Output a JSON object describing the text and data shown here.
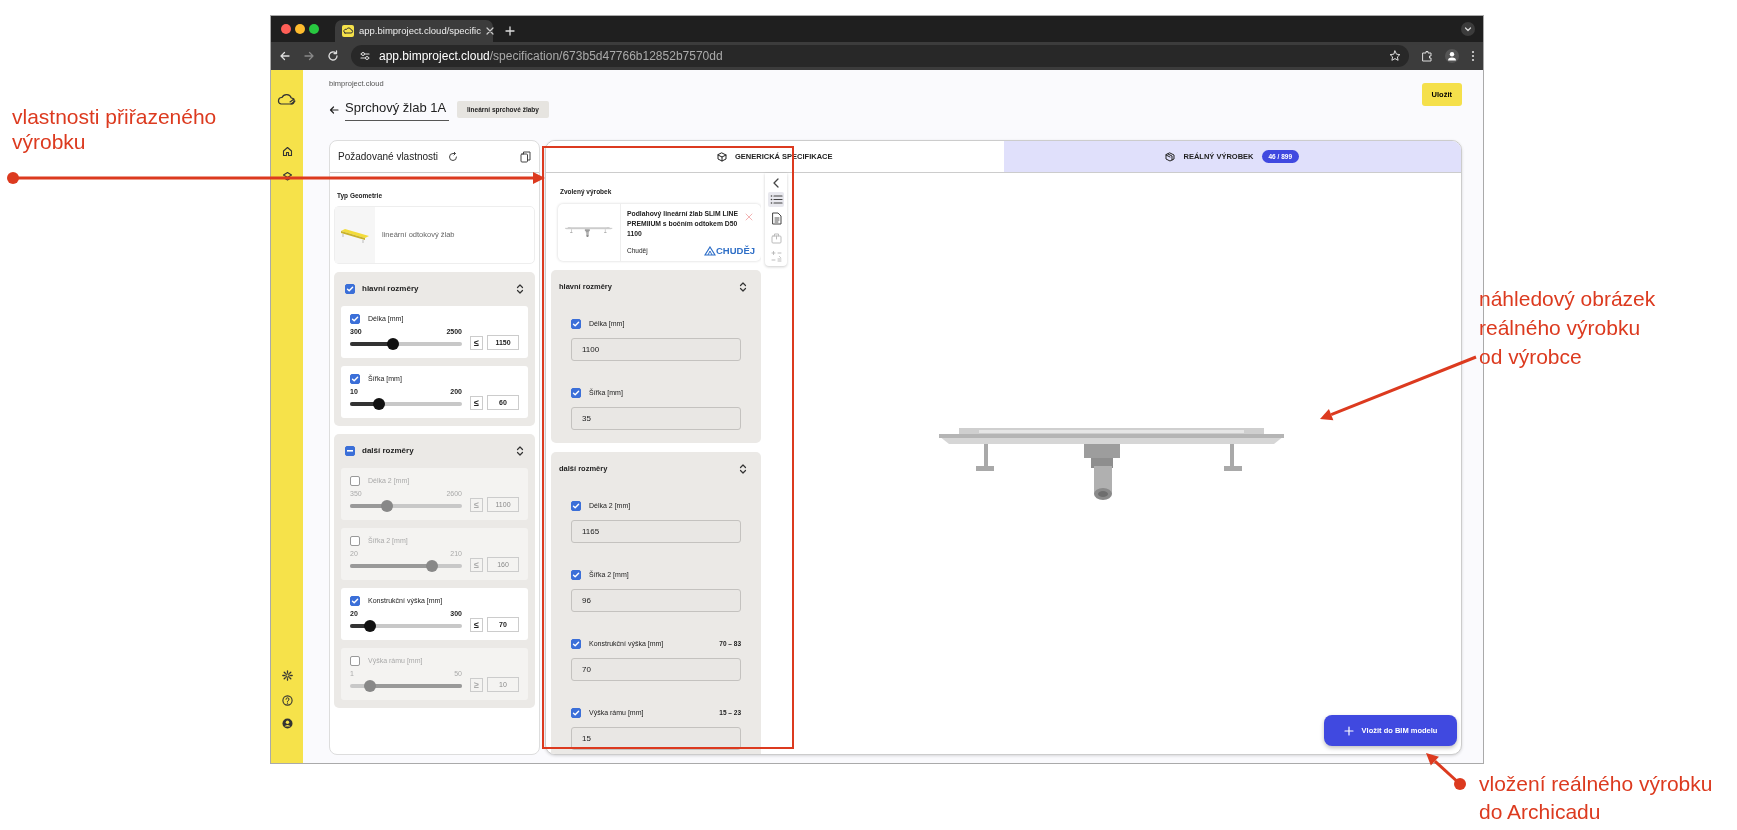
{
  "browser": {
    "tab_title": "app.bimproject.cloud/specific",
    "url_host": "app.bimproject.cloud",
    "url_path": "/specification/673b5d47766b12852b7570dd"
  },
  "header": {
    "site": "bimproject.cloud",
    "title": "Sprchový žlab 1A",
    "category": "lineární sprchové žlaby",
    "save_button": "Uložit"
  },
  "required_properties": {
    "title": "Požadované vlastnosti",
    "geometry_label": "Typ Geometrie",
    "geometry_name": "lineární odtokový žlab",
    "groups": [
      {
        "title": "hlavní rozměry",
        "checked": true,
        "partial": false,
        "properties": [
          {
            "label": "Délka [mm]",
            "checked": true,
            "min": "300",
            "max": "2500",
            "level": 0.38,
            "fill_right": false,
            "operator": "≤",
            "value": "1150"
          },
          {
            "label": "Šířka [mm]",
            "checked": true,
            "min": "10",
            "max": "200",
            "level": 0.26,
            "fill_right": false,
            "operator": "≤",
            "value": "60"
          }
        ]
      },
      {
        "title": "další rozměry",
        "partial": true,
        "properties": [
          {
            "label": "Délka 2 [mm]",
            "checked": false,
            "min": "350",
            "max": "2600",
            "level": 0.33,
            "fill_right": false,
            "operator": "≤",
            "value": "1100"
          },
          {
            "label": "Šířka 2 [mm]",
            "checked": false,
            "min": "20",
            "max": "210",
            "level": 0.73,
            "fill_right": false,
            "operator": "≤",
            "value": "160"
          },
          {
            "label": "Konstrukční výška [mm]",
            "checked": true,
            "min": "20",
            "max": "300",
            "level": 0.18,
            "fill_right": false,
            "operator": "≤",
            "value": "70"
          },
          {
            "label": "Výška rámu [mm]",
            "checked": false,
            "min": "1",
            "max": "50",
            "level": 0.18,
            "fill_right": true,
            "operator": "≥",
            "value": "10"
          }
        ]
      }
    ]
  },
  "tabs": [
    {
      "label": "GENERICKÁ SPECIFIKACE",
      "selected": false
    },
    {
      "label": "REÁLNÝ VÝROBEK",
      "badge": "46 / 899",
      "selected": true
    }
  ],
  "selected_product": {
    "heading": "Zvolený výrobek",
    "name": "Podlahový lineární žlab SLIM LINE PREMIIUM s bočním odtokem D50 1100",
    "manufacturer": "Chuděj",
    "logo": "CHUDĚJ",
    "groups": [
      {
        "title": "hlavní rozměry",
        "properties": [
          {
            "label": "Délka [mm]",
            "checked": true,
            "value": "1100"
          },
          {
            "label": "Šířka [mm]",
            "checked": true,
            "value": "35"
          }
        ]
      },
      {
        "title": "další rozměry",
        "properties": [
          {
            "label": "Délka 2 [mm]",
            "checked": true,
            "value": "1165"
          },
          {
            "label": "Šířka 2 [mm]",
            "checked": true,
            "value": "96"
          },
          {
            "label": "Konstrukční výška [mm]",
            "checked": true,
            "range": "70 – 83",
            "value": "70"
          },
          {
            "label": "Výška rámu [mm]",
            "checked": true,
            "range": "15 – 23",
            "value": "15"
          }
        ]
      }
    ]
  },
  "tools": [
    {
      "kind": "list",
      "selected": true,
      "disabled": false
    },
    {
      "kind": "document",
      "selected": false,
      "disabled": false
    },
    {
      "kind": "package",
      "selected": false,
      "disabled": true
    },
    {
      "kind": "compare",
      "selected": false,
      "disabled": true
    }
  ],
  "insert_button": "Vložit do BIM modelu",
  "annotations": [
    {
      "text": "vlastnosti přiřazeného\nvýrobku"
    },
    {
      "text": "náhledový obrázek\nreálného výrobku\nod výrobce"
    },
    {
      "text": "vložení reálného výrobku\ndo Archicadu"
    }
  ]
}
